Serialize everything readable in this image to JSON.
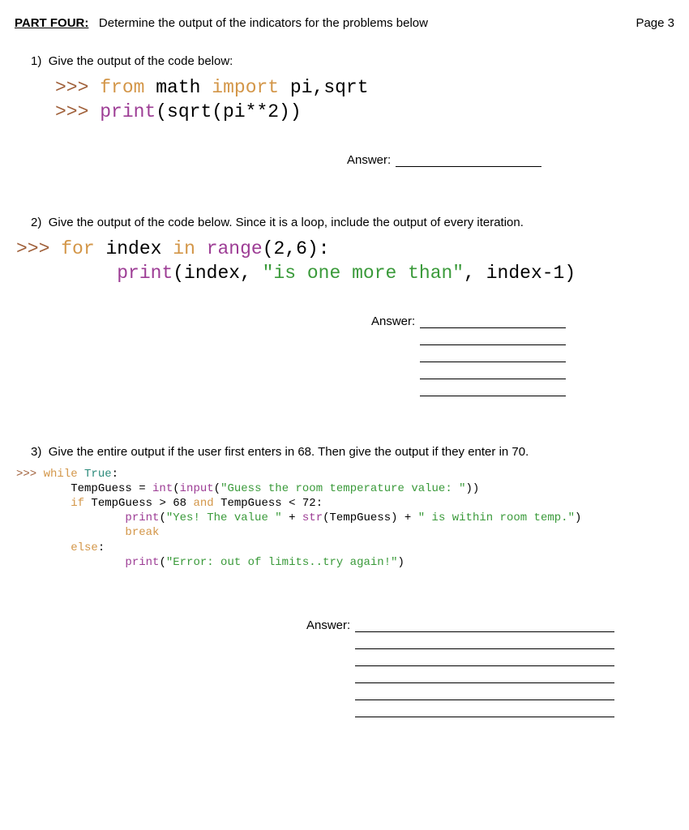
{
  "header": {
    "part": "PART FOUR:",
    "instruction": "Determine the output of the indicators for the problems below",
    "page": "Page 3"
  },
  "answer_label": "Answer:",
  "q1": {
    "num": "1)",
    "prompt": "Give the output of the code below:",
    "code": {
      "p1": ">>> ",
      "from": "from",
      "sp1": " ",
      "math": "math",
      "sp2": " ",
      "import": "import",
      "sp3": " ",
      "args1": "pi,sqrt",
      "p2": ">>> ",
      "print": "print",
      "paren": "(sqrt(pi**2))"
    }
  },
  "q2": {
    "num": "2)",
    "prompt": "Give the output of the code below. Since it is a loop, include the output of every iteration.",
    "code": {
      "p1": ">>> ",
      "for": "for",
      "sp1": " ",
      "index": "index",
      "sp2": " ",
      "in": "in",
      "sp3": " ",
      "range": "range",
      "args": "(2,6):",
      "indent": "         ",
      "print": "print",
      "lp": "(index, ",
      "str": "\"is one more than\"",
      "rp": ", index-1)"
    }
  },
  "q3": {
    "num": "3)",
    "prompt": "Give the entire output if the user first enters in 68. Then give the output if they enter in 70.",
    "code": {
      "p1": ">>> ",
      "while": "while",
      "sp": " ",
      "true": "True",
      "colon": ":",
      "l2a": "        TempGuess = ",
      "int": "int",
      "l2b": "(",
      "input": "input",
      "l2c": "(",
      "s1": "\"Guess the room temperature value: \"",
      "l2d": "))",
      "l3a": "        ",
      "if": "if",
      "l3b": " TempGuess > 68 ",
      "and": "and",
      "l3c": " TempGuess < 72:",
      "l4a": "                ",
      "print4": "print",
      "l4b": "(",
      "s2": "\"Yes! The value \"",
      "l4c": " + ",
      "str": "str",
      "l4d": "(TempGuess) + ",
      "s3": "\" is within room temp.\"",
      "l4e": ")",
      "l5a": "                ",
      "break": "break",
      "l6a": "        ",
      "else": "else",
      "l6b": ":",
      "l7a": "                ",
      "print7": "print",
      "l7b": "(",
      "s4": "\"Error: out of limits..try again!\"",
      "l7c": ")"
    }
  }
}
